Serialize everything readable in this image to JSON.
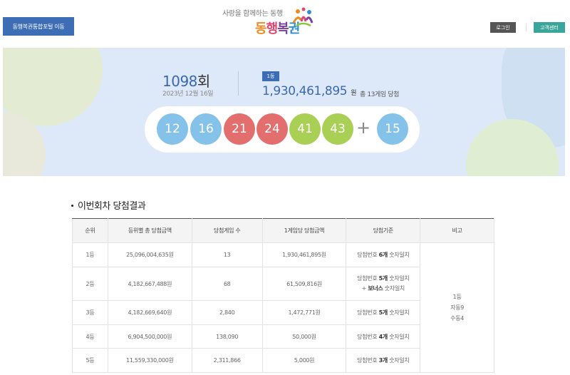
{
  "header": {
    "portal_button": "동행복권통합포털 이동",
    "slogan": "사랑을 함께하는 동행",
    "brand": [
      "동",
      "행",
      "복",
      "권"
    ],
    "login": "로그인",
    "support": "고객센터"
  },
  "draw": {
    "number": "1098",
    "unit": "회",
    "date": "2023년 12월 16일",
    "rank_badge": "1등",
    "prize_amount": "1,930,461,895",
    "prize_unit": "원",
    "prize_count_text": "총 13게임 당첨",
    "numbers": [
      {
        "value": "12",
        "color": "#85c2ea"
      },
      {
        "value": "16",
        "color": "#85c2ea"
      },
      {
        "value": "21",
        "color": "#e26e6e"
      },
      {
        "value": "24",
        "color": "#e26e6e"
      },
      {
        "value": "41",
        "color": "#a9cf55"
      },
      {
        "value": "43",
        "color": "#a9cf55"
      }
    ],
    "plus": "+",
    "bonus": {
      "value": "15",
      "color": "#85c2ea"
    }
  },
  "results": {
    "title": "이번회차 당첨결과",
    "headers": [
      "순위",
      "등위별 총 당첨금액",
      "당첨게임 수",
      "1게임당 당첨금액",
      "당첨기준",
      "비고"
    ],
    "rows": [
      {
        "rank": "1등",
        "total": "25,096,004,635원",
        "winners": "13",
        "per_game": "1,930,461,895원",
        "crit_pre": "당첨번호 ",
        "crit_hl": "6개",
        "crit_post": " 숫자일치",
        "crit_line2": ""
      },
      {
        "rank": "2등",
        "total": "4,182,667,488원",
        "winners": "68",
        "per_game": "61,509,816원",
        "crit_pre": "당첨번호 ",
        "crit_hl": "5개",
        "crit_post": " 숫자일치",
        "crit_line2_pre": "+ ",
        "crit_line2_hl": "보너스",
        "crit_line2_post": " 숫자일치"
      },
      {
        "rank": "3등",
        "total": "4,182,669,640원",
        "winners": "2,840",
        "per_game": "1,472,771원",
        "crit_pre": "당첨번호 ",
        "crit_hl": "5개",
        "crit_post": " 숫자일치"
      },
      {
        "rank": "4등",
        "total": "6,904,500,000원",
        "winners": "138,090",
        "per_game": "50,000원",
        "crit_pre": "당첨번호 ",
        "crit_hl": "4개",
        "crit_post": " 숫자일치"
      },
      {
        "rank": "5등",
        "total": "11,559,330,000원",
        "winners": "2,311,866",
        "per_game": "5,000원",
        "crit_pre": "당첨번호 ",
        "crit_hl": "3개",
        "crit_post": " 숫자일치"
      }
    ],
    "note_lines": [
      "1등",
      "자동9",
      "수동4"
    ]
  },
  "colors": {
    "accent": "#3d6db5",
    "support": "#3aa59a",
    "banner_bg": "#dde9f8"
  }
}
